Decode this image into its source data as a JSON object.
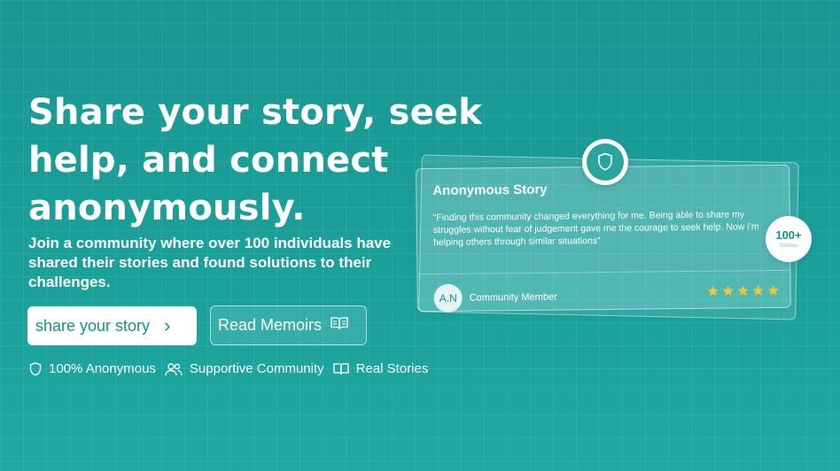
{
  "hero": {
    "title": "Share your story, seek help, and connect anonymously.",
    "subtitle": "Join a community where over 100 individuals have shared their stories and found solutions to their challenges."
  },
  "actions": {
    "share_label": "share your story",
    "read_label": "Read Memoirs"
  },
  "features": [
    {
      "label": "100% Anonymous",
      "icon": "shield-icon"
    },
    {
      "label": "Supportive Community",
      "icon": "users-icon"
    },
    {
      "label": "Real Stories",
      "icon": "book-icon"
    }
  ],
  "story_card": {
    "title": "Anonymous Story",
    "quote": "“Finding this community changed everything for me. Being able to share my struggles without fear of judgement gave me the courage to seek help. Now i’m helping others through similar situations”",
    "author_initials": "A.N",
    "author_role": "Community Member",
    "rating": 5
  },
  "stories_badge": {
    "count": "100+",
    "label": "Stories"
  },
  "colors": {
    "background": "#1a9a94",
    "accent_text": "#16918b",
    "star": "#f7c531"
  }
}
